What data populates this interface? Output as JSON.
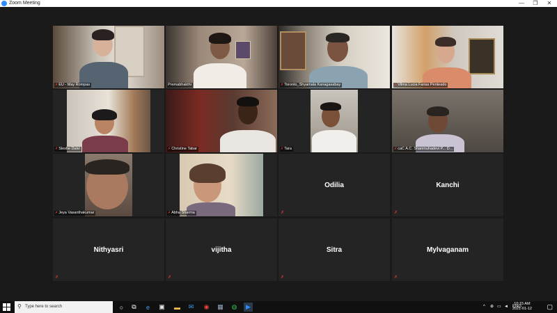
{
  "window": {
    "title": "Zoom Meeting",
    "icon": "zoom-icon"
  },
  "window_controls": {
    "minimize": "—",
    "maximize": "❐",
    "close": "✕"
  },
  "participants_video": [
    {
      "name": "EU - May Rompas",
      "muted": true
    },
    {
      "name": "Premabhakthi",
      "muted": false,
      "active_speaker": true
    },
    {
      "name": "Toronto_Shyamala Kanagasabay",
      "muted": true
    },
    {
      "name": "Vilma Lucia Farias Penteado",
      "muted": true
    },
    {
      "name": "Sleshe Dalvi",
      "muted": true
    },
    {
      "name": "Christine Tabar",
      "muted": true
    },
    {
      "name": "Tara",
      "muted": true
    },
    {
      "name": "caC A.C. Shanmuhadevi P... D...",
      "muted": true
    },
    {
      "name": "Jeya Vasanthakumar",
      "muted": true
    },
    {
      "name": "Abha Sharma",
      "muted": true
    }
  ],
  "participants_no_video": [
    {
      "name": "Odilia"
    },
    {
      "name": "Kanchi"
    },
    {
      "name": "Nithyasri"
    },
    {
      "name": "vijitha"
    },
    {
      "name": "Sitra"
    },
    {
      "name": "Mylvaganam"
    }
  ],
  "taskbar": {
    "search_placeholder": "Type here to search",
    "language": "ENG",
    "time": "10:15 AM",
    "date": "2021-01-12"
  },
  "colors": {
    "active_speaker_border": "#c8e04a",
    "muted_icon": "#e03b3b",
    "tile_bg": "#242424"
  }
}
